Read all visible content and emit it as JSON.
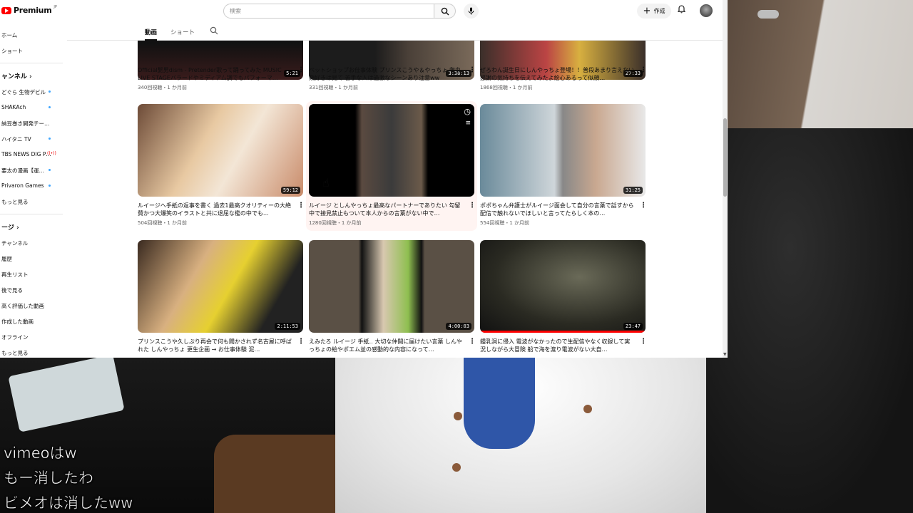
{
  "header": {
    "logo_text": "Premium",
    "logo_region": "JP",
    "search_placeholder": "検索",
    "create_label": "作成"
  },
  "sidebar": {
    "items_top": [
      "ホーム",
      "ショート"
    ],
    "channels_header": "ャンネル",
    "channels": [
      {
        "label": "どぐら 生物デビル",
        "dot": true,
        "live": false
      },
      {
        "label": "SHAKAch",
        "dot": true,
        "live": false
      },
      {
        "label": "納豆巻き開発チー…",
        "dot": false,
        "live": false
      },
      {
        "label": "ハイタニ TV",
        "dot": true,
        "live": false
      },
      {
        "label": "TBS NEWS DIG P…",
        "dot": false,
        "live": true
      },
      {
        "label": "要太の漫画【運…",
        "dot": true,
        "live": false
      },
      {
        "label": "Privaron Games",
        "dot": true,
        "live": false
      },
      {
        "label": "もっと見る",
        "dot": false,
        "live": false
      }
    ],
    "you_header": "ージ",
    "you_items": [
      "チャンネル",
      "履歴",
      "再生リスト",
      "後で見る",
      "高く評価した動画",
      "作成した動画",
      "オフライン",
      "もっと見る"
    ]
  },
  "tabs": {
    "videos": "動画",
    "shorts": "ショート"
  },
  "videos": [
    {
      "title": "Official髭男dism - Pretender歌って踊ってみた MUSIC LIVE STAGEバラードやミディアム調でもパフォーマ…",
      "meta": "340回視聴・1 か月前",
      "duration": "5:21"
    },
    {
      "title": "ペットショップお仕事体験 プリンスこうや＆やっちょ 爬虫類好きは見て 苦手な人は過激なシーンあり注意ww",
      "meta": "331回視聴・1 か月前",
      "duration": "3:38:13"
    },
    {
      "title": "ぜろわん誕生日にしんやっちょ登場！！普段あまり言えない感謝の気持ちを伝えてみたよ絵心あるって似顔…",
      "meta": "1868回視聴・1 か月前",
      "duration": "27:33"
    },
    {
      "title": "ルイージへ手紙の返事を書く 過去1最高クオリティーの大絶賛かつ大爆笑のイラストと共に退屈な檻の中でも…",
      "meta": "504回視聴・1 か月前",
      "duration": "59:12"
    },
    {
      "title": "ルイージ としんやっちょ最高なパートナーでありたい 勾留中で接見禁止もついて本人からの言葉がない中で…",
      "meta": "1280回視聴・1 か月前",
      "duration": ""
    },
    {
      "title": "ポポちゃん弁護士がルイージ面会して自分の言葉で話すから配信で触れないでほしいと言ってたらしく本の…",
      "meta": "554回視聴・1 か月前",
      "duration": "31:25"
    },
    {
      "title": "プリンスこうや久しぶり再会で何も聞かされず名古屋に呼ばれた しんやっちょ 更生企画 → お仕事体験 泥…",
      "meta": "",
      "duration": "2:11:53"
    },
    {
      "title": "えみたろ ルイージ 手紙‥ 大切な仲間に届けたい言葉 しんやっちょの絵やポエム並の感動的な内容になって…",
      "meta": "",
      "duration": "4:00:03"
    },
    {
      "title": "鍾乳洞に侵入 電波がなかったので生配信やなく収録して実況しながら大冒険 船で海を渡り電波がない大自…",
      "meta": "",
      "duration": "23:47"
    }
  ],
  "chat": [
    "vimeoはw",
    "もー消したわ",
    "ビメオは消したww"
  ]
}
